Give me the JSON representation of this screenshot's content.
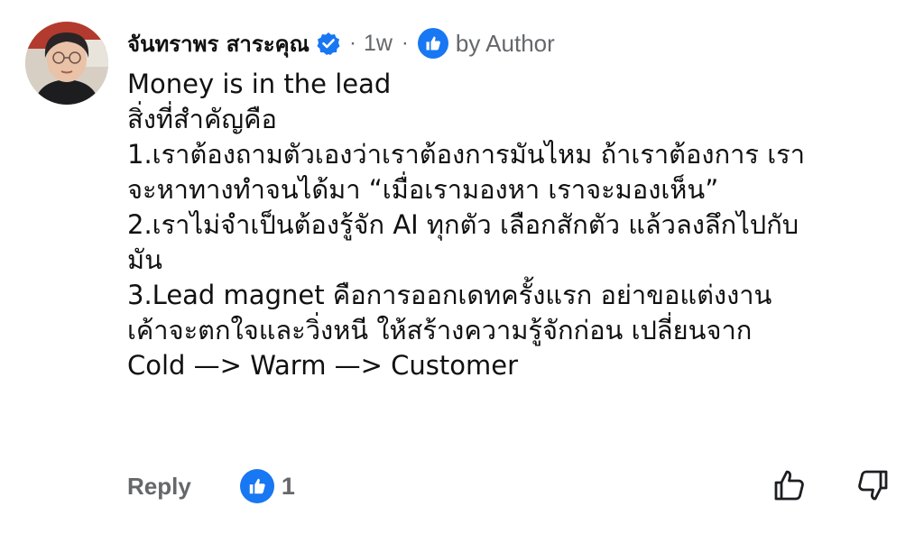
{
  "comment": {
    "author": "จันทราพร สาระคุณ",
    "separator": "·",
    "time": "1w",
    "badge_label": "by Author",
    "body_lines": [
      "Money is in the lead",
      "สิ่งที่สำคัญคือ",
      "1.เราต้องถามตัวเองว่าเราต้องการมันไหม ถ้าเราต้องการ เรา",
      "จะหาทางทำจนได้มา “เมื่อเรามองหา เราจะมองเห็น”",
      "2.เราไม่จำเป็นต้องรู้จัก AI ทุกตัว เลือกสักตัว แล้วลงลึกไปกับ",
      "มัน",
      "3.Lead magnet คือการออกเดทครั้งแรก อย่าขอแต่งงาน",
      "เค้าจะตกใจและวิ่งหนี ให้สร้างความรู้จักก่อน เปลี่ยนจาก",
      "Cold —> Warm —> Customer"
    ],
    "reply_label": "Reply",
    "reaction_count": "1",
    "icons": {
      "verified": "verified-badge-icon",
      "author_like": "like-icon",
      "reaction": "like-icon",
      "upvote": "thumbs-up-outline-icon",
      "downvote": "thumbs-down-outline-icon"
    },
    "colors": {
      "accent": "#1877f2",
      "secondary_text": "#65676b",
      "primary_text": "#111111"
    }
  }
}
